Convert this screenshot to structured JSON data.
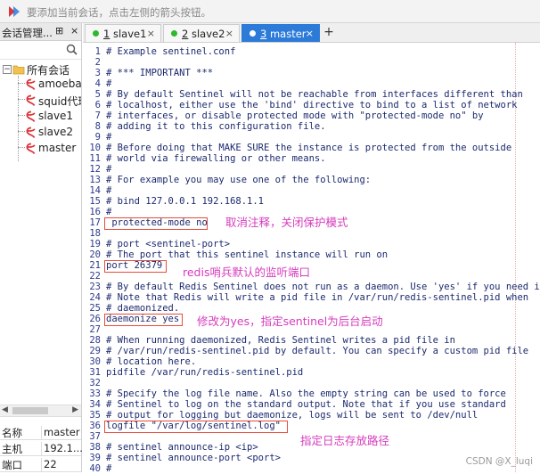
{
  "topbar": {
    "hint": "要添加当前会话，点击左侧的箭头按钮。",
    "logo_icon": "xshell-logo-icon"
  },
  "sidebar": {
    "title": "会话管理...",
    "pin_glyph": "⊞",
    "close_glyph": "×",
    "search_icon": "search-icon",
    "root_label": "所有会话",
    "items": [
      {
        "label": "amoeba"
      },
      {
        "label": "squid代理"
      },
      {
        "label": "slave1"
      },
      {
        "label": "slave2"
      },
      {
        "label": "master"
      }
    ]
  },
  "properties": [
    {
      "key": "名称",
      "value": "master"
    },
    {
      "key": "主机",
      "value": "192.1..."
    },
    {
      "key": "端口",
      "value": "22"
    }
  ],
  "tabs": [
    {
      "num": "1",
      "label": "slave1",
      "dot_color": "#2eb82e",
      "active": false
    },
    {
      "num": "2",
      "label": "slave2",
      "dot_color": "#2eb82e",
      "active": false
    },
    {
      "num": "3",
      "label": "master",
      "dot_color": "#ffffff",
      "active": true
    }
  ],
  "new_tab_label": "+",
  "code_lines": [
    {
      "n": "1",
      "text": "# Example sentinel.conf"
    },
    {
      "n": "2",
      "text": ""
    },
    {
      "n": "3",
      "text": "# *** IMPORTANT ***"
    },
    {
      "n": "4",
      "text": "#"
    },
    {
      "n": "5",
      "text": "# By default Sentinel will not be reachable from interfaces different than"
    },
    {
      "n": "6",
      "text": "# localhost, either use the 'bind' directive to bind to a list of network"
    },
    {
      "n": "7",
      "text": "# interfaces, or disable protected mode with \"protected-mode no\" by"
    },
    {
      "n": "8",
      "text": "# adding it to this configuration file."
    },
    {
      "n": "9",
      "text": "#"
    },
    {
      "n": "10",
      "text": "# Before doing that MAKE SURE the instance is protected from the outside"
    },
    {
      "n": "11",
      "text": "# world via firewalling or other means."
    },
    {
      "n": "12",
      "text": "#"
    },
    {
      "n": "13",
      "text": "# For example you may use one of the following:"
    },
    {
      "n": "14",
      "text": "#"
    },
    {
      "n": "15",
      "text": "# bind 127.0.0.1 192.168.1.1"
    },
    {
      "n": "16",
      "text": "#"
    },
    {
      "n": "17",
      "text": " protected-mode no"
    },
    {
      "n": "18",
      "text": ""
    },
    {
      "n": "19",
      "text": "# port <sentinel-port>"
    },
    {
      "n": "20",
      "text": "# The port that this sentinel instance will run on"
    },
    {
      "n": "21",
      "text": "port 26379"
    },
    {
      "n": "22",
      "text": ""
    },
    {
      "n": "23",
      "text": "# By default Redis Sentinel does not run as a daemon. Use 'yes' if you need it."
    },
    {
      "n": "24",
      "text": "# Note that Redis will write a pid file in /var/run/redis-sentinel.pid when"
    },
    {
      "n": "25",
      "text": "# daemonized."
    },
    {
      "n": "26",
      "text": "daemonize yes"
    },
    {
      "n": "27",
      "text": ""
    },
    {
      "n": "28",
      "text": "# When running daemonized, Redis Sentinel writes a pid file in"
    },
    {
      "n": "29",
      "text": "# /var/run/redis-sentinel.pid by default. You can specify a custom pid file"
    },
    {
      "n": "30",
      "text": "# location here."
    },
    {
      "n": "31",
      "text": "pidfile /var/run/redis-sentinel.pid"
    },
    {
      "n": "32",
      "text": ""
    },
    {
      "n": "33",
      "text": "# Specify the log file name. Also the empty string can be used to force"
    },
    {
      "n": "34",
      "text": "# Sentinel to log on the standard output. Note that if you use standard"
    },
    {
      "n": "35",
      "text": "# output for logging but daemonize, logs will be sent to /dev/null"
    },
    {
      "n": "36",
      "text": "logfile \"/var/log/sentinel.log\""
    },
    {
      "n": "37",
      "text": ""
    },
    {
      "n": "38",
      "text": "# sentinel announce-ip <ip>"
    },
    {
      "n": "39",
      "text": "# sentinel announce-port <port>"
    },
    {
      "n": "40",
      "text": "#"
    }
  ],
  "annotations": {
    "protected_mode": "取消注释，关闭保护模式",
    "port": "redis哨兵默认的监听端口",
    "daemonize": "修改为yes，指定sentinel为后台启动",
    "logfile": "指定日志存放路径"
  },
  "colors": {
    "annotation": "#d63cbd",
    "highlight_border": "#e74c3c",
    "active_tab": "#2d7bd8",
    "code_text": "#1c2a6e"
  },
  "watermark": "CSDN @X_luqi"
}
